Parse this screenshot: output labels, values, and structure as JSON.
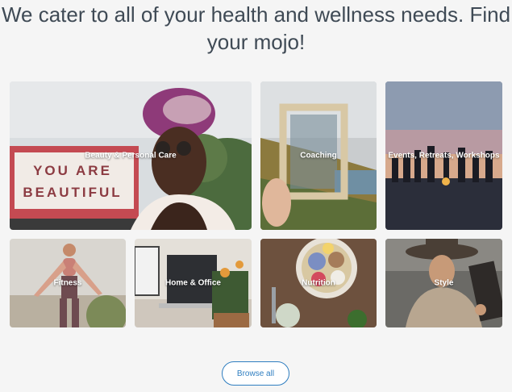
{
  "headline": "We cater to all of your health and wellness needs. Find your mojo!",
  "categories": [
    {
      "label": "Beauty & Personal Care",
      "icon": "beauty-photo"
    },
    {
      "label": "Coaching",
      "icon": "coaching-photo"
    },
    {
      "label": "Events, Retreats, Workshops",
      "icon": "events-photo"
    },
    {
      "label": "Fitness",
      "icon": "fitness-photo"
    },
    {
      "label": "Home & Office",
      "icon": "home-office-photo"
    },
    {
      "label": "Nutrition",
      "icon": "nutrition-photo"
    },
    {
      "label": "Style",
      "icon": "style-photo"
    }
  ],
  "beauty_sign": {
    "line1": "YOU ARE",
    "line2": "BEAUTIFUL"
  },
  "browse_label": "Browse all",
  "colors": {
    "accent": "#2f7ec0",
    "headline": "#3f4a55",
    "background": "#f5f5f5"
  }
}
